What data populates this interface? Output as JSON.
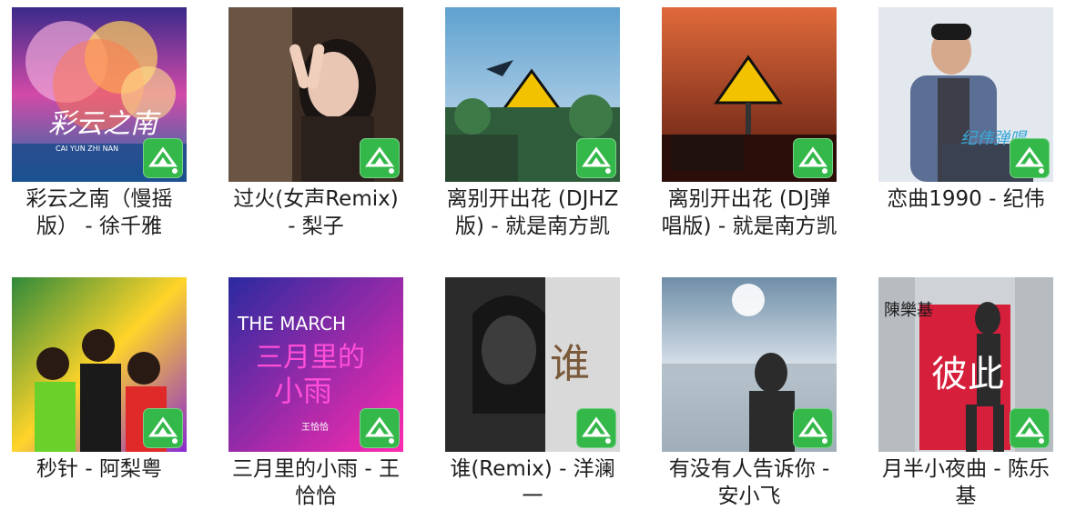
{
  "songs": [
    {
      "title": "彩云之南（慢摇版） - 徐千雅",
      "cover_text": "彩云之南",
      "cover_subtext": "CAI YUN ZHI NAN"
    },
    {
      "title": "过火(女声Remix) - 梨子"
    },
    {
      "title": "离别开出花 (DJHZ版) - 就是南方凯"
    },
    {
      "title": "离别开出花 (DJ弹唱版) - 就是南方凯"
    },
    {
      "title": "恋曲1990 - 纪伟",
      "cover_text": "纪伟弹唱"
    },
    {
      "title": "秒针 - 阿梨粤"
    },
    {
      "title": "三月里的小雨 - 王恰恰",
      "cover_text": "THE MARCH",
      "cover_text2": "三月里的",
      "cover_text3": "小雨",
      "cover_subtext": "王恰恰"
    },
    {
      "title": "谁(Remix) - 洋澜一",
      "cover_text": "谁"
    },
    {
      "title": "有没有人告诉你 - 安小飞"
    },
    {
      "title": "月半小夜曲 - 陈乐基",
      "cover_text": "彼此",
      "cover_subtext": "陳樂基"
    }
  ],
  "badge_icon": "music-app-badge-icon",
  "colors": {
    "badge": "#34b84a",
    "title_text": "#1e1e1e",
    "background": "#ffffff"
  }
}
